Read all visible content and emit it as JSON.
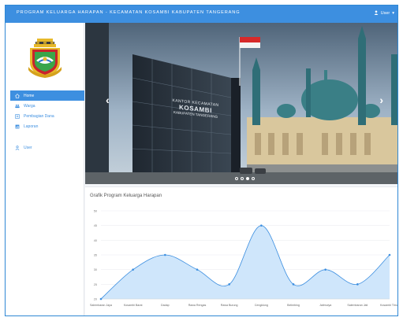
{
  "header": {
    "app_title": "PROGRAM KELUARGA HARAPAN  -  KECAMATAN KOSAMBI KABUPATEN TANGERANG",
    "user_label": "User"
  },
  "sidebar": {
    "items": [
      {
        "label": "Home",
        "icon": "home-icon",
        "active": true
      },
      {
        "label": "Warga",
        "icon": "users-icon",
        "active": false
      },
      {
        "label": "Pembagian Dana",
        "icon": "list-icon",
        "active": false
      },
      {
        "label": "Laporan",
        "icon": "report-icon",
        "active": false
      }
    ],
    "user_item": {
      "label": "User",
      "icon": "user-icon"
    }
  },
  "carousel": {
    "building_sign": {
      "line1": "KANTOR KECAMATAN",
      "line2": "KOSAMBI",
      "line3": "KABUPATEN TANGERANG"
    },
    "active_slide": 2,
    "slide_count": 4
  },
  "chart": {
    "title": "Grafik Program Keluarga Harapan"
  },
  "chart_data": {
    "type": "area",
    "title": "Grafik Program Keluarga Harapan",
    "categories": [
      "Salembaran Jaya",
      "Kosambi Barat",
      "Dadap",
      "Rawa Rengas",
      "Rawa Burung",
      "Cengklong",
      "Belimbing",
      "Jatimulya",
      "Salembaran Jati",
      "Kosambi Timur"
    ],
    "values": [
      20,
      30,
      35,
      30,
      25,
      45,
      25,
      30,
      25,
      35
    ],
    "yticks": [
      20,
      25,
      30,
      35,
      40,
      45,
      50
    ],
    "ylim": [
      20,
      50
    ],
    "grid": true,
    "colors": {
      "fill": "#cfe6fb",
      "line": "#3d8fe0"
    }
  }
}
